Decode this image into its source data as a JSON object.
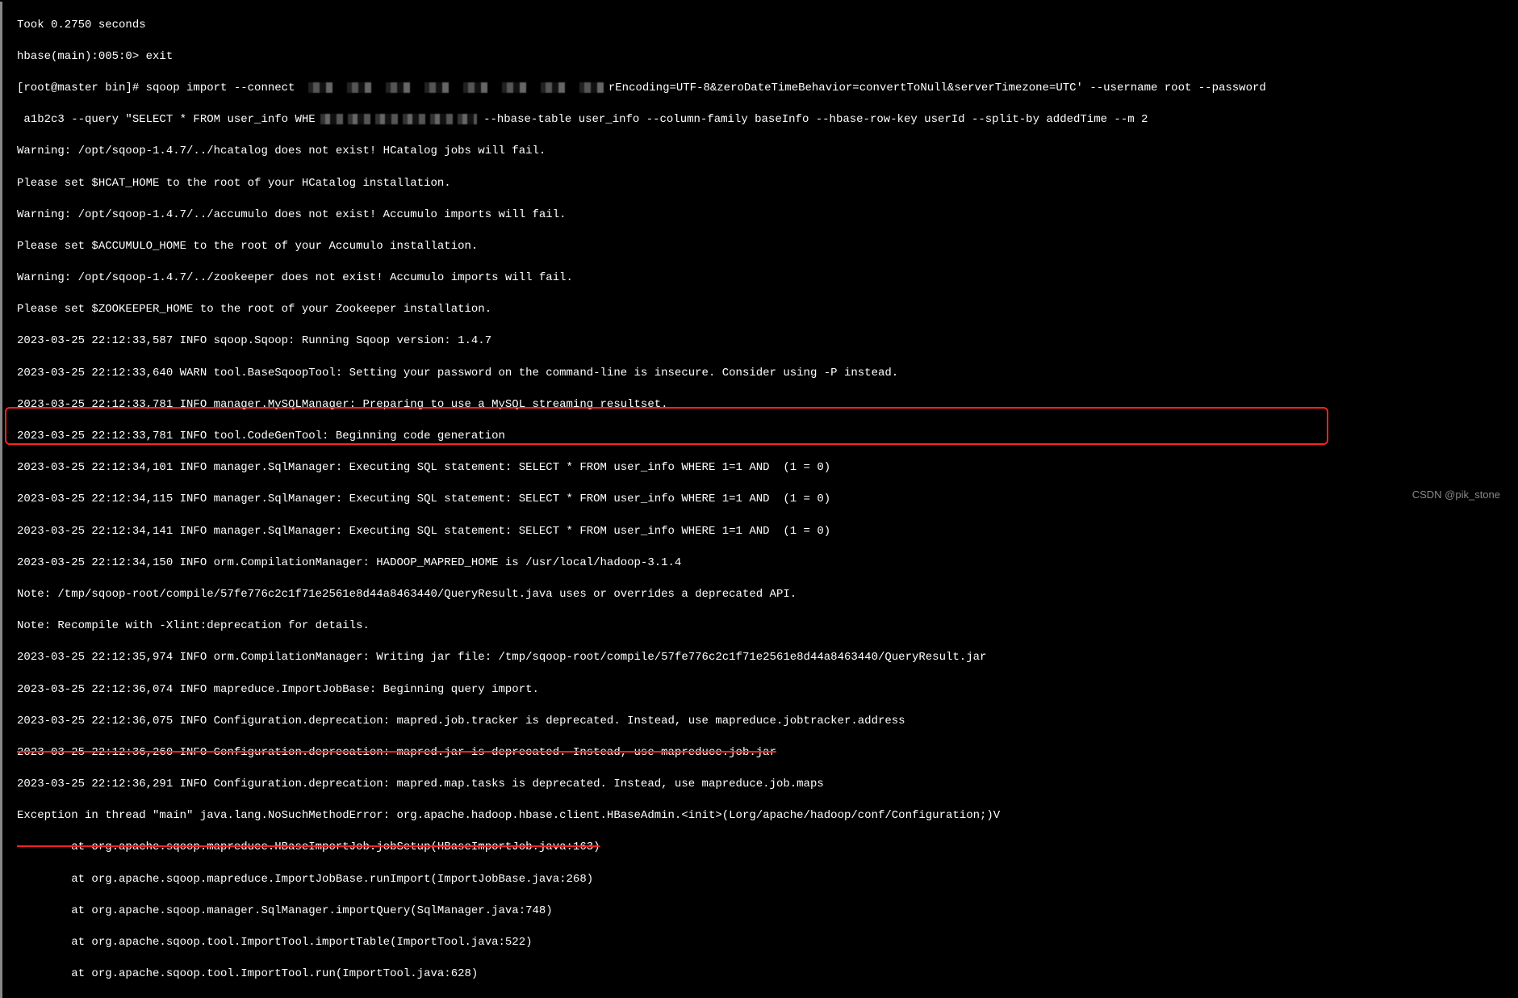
{
  "lines": {
    "l00": "Took 0.2750 seconds",
    "l01": "hbase(main):005:0> exit",
    "l02a": "[root@master bin]# sqoop import --connect ",
    "l02b": "rEncoding=UTF-8&zeroDateTimeBehavior=convertToNull&serverTimezone=UTC' --username root --password",
    "l03a": " a1b2c3 --query \"SELECT * FROM user_info WHE",
    "l03b": " --hbase-table user_info --column-family baseInfo --hbase-row-key userId --split-by addedTime --m 2",
    "l04": "Warning: /opt/sqoop-1.4.7/../hcatalog does not exist! HCatalog jobs will fail.",
    "l05": "Please set $HCAT_HOME to the root of your HCatalog installation.",
    "l06": "Warning: /opt/sqoop-1.4.7/../accumulo does not exist! Accumulo imports will fail.",
    "l07": "Please set $ACCUMULO_HOME to the root of your Accumulo installation.",
    "l08": "Warning: /opt/sqoop-1.4.7/../zookeeper does not exist! Accumulo imports will fail.",
    "l09": "Please set $ZOOKEEPER_HOME to the root of your Zookeeper installation.",
    "l10": "2023-03-25 22:12:33,587 INFO sqoop.Sqoop: Running Sqoop version: 1.4.7",
    "l11": "2023-03-25 22:12:33,640 WARN tool.BaseSqoopTool: Setting your password on the command-line is insecure. Consider using -P instead.",
    "l12": "2023-03-25 22:12:33,781 INFO manager.MySQLManager: Preparing to use a MySQL streaming resultset.",
    "l13": "2023-03-25 22:12:33,781 INFO tool.CodeGenTool: Beginning code generation",
    "l14": "2023-03-25 22:12:34,101 INFO manager.SqlManager: Executing SQL statement: SELECT * FROM user_info WHERE 1=1 AND  (1 = 0)",
    "l15": "2023-03-25 22:12:34,115 INFO manager.SqlManager: Executing SQL statement: SELECT * FROM user_info WHERE 1=1 AND  (1 = 0)",
    "l16": "2023-03-25 22:12:34,141 INFO manager.SqlManager: Executing SQL statement: SELECT * FROM user_info WHERE 1=1 AND  (1 = 0)",
    "l17": "2023-03-25 22:12:34,150 INFO orm.CompilationManager: HADOOP_MAPRED_HOME is /usr/local/hadoop-3.1.4",
    "l18": "Note: /tmp/sqoop-root/compile/57fe776c2c1f71e2561e8d44a8463440/QueryResult.java uses or overrides a deprecated API.",
    "l19": "Note: Recompile with -Xlint:deprecation for details.",
    "l20": "2023-03-25 22:12:35,974 INFO orm.CompilationManager: Writing jar file: /tmp/sqoop-root/compile/57fe776c2c1f71e2561e8d44a8463440/QueryResult.jar",
    "l21": "2023-03-25 22:12:36,074 INFO mapreduce.ImportJobBase: Beginning query import.",
    "l22": "2023-03-25 22:12:36,075 INFO Configuration.deprecation: mapred.job.tracker is deprecated. Instead, use mapreduce.jobtracker.address",
    "l23": "2023-03-25 22:12:36,260 INFO Configuration.deprecation: mapred.jar is deprecated. Instead, use mapreduce.job.jar",
    "l24": "2023-03-25 22:12:36,291 INFO Configuration.deprecation: mapred.map.tasks is deprecated. Instead, use mapreduce.job.maps",
    "l25": "Exception in thread \"main\" java.lang.NoSuchMethodError: org.apache.hadoop.hbase.client.HBaseAdmin.<init>(Lorg/apache/hadoop/conf/Configuration;)V",
    "l26": "        at org.apache.sqoop.mapreduce.HBaseImportJob.jobSetup(HBaseImportJob.java:163)",
    "l27": "        at org.apache.sqoop.mapreduce.ImportJobBase.runImport(ImportJobBase.java:268)",
    "l28": "        at org.apache.sqoop.manager.SqlManager.importQuery(SqlManager.java:748)",
    "l29": "        at org.apache.sqoop.tool.ImportTool.importTable(ImportTool.java:522)",
    "l30": "        at org.apache.sqoop.tool.ImportTool.run(ImportTool.java:628)"
  },
  "watermark": "CSDN @pik_stone"
}
